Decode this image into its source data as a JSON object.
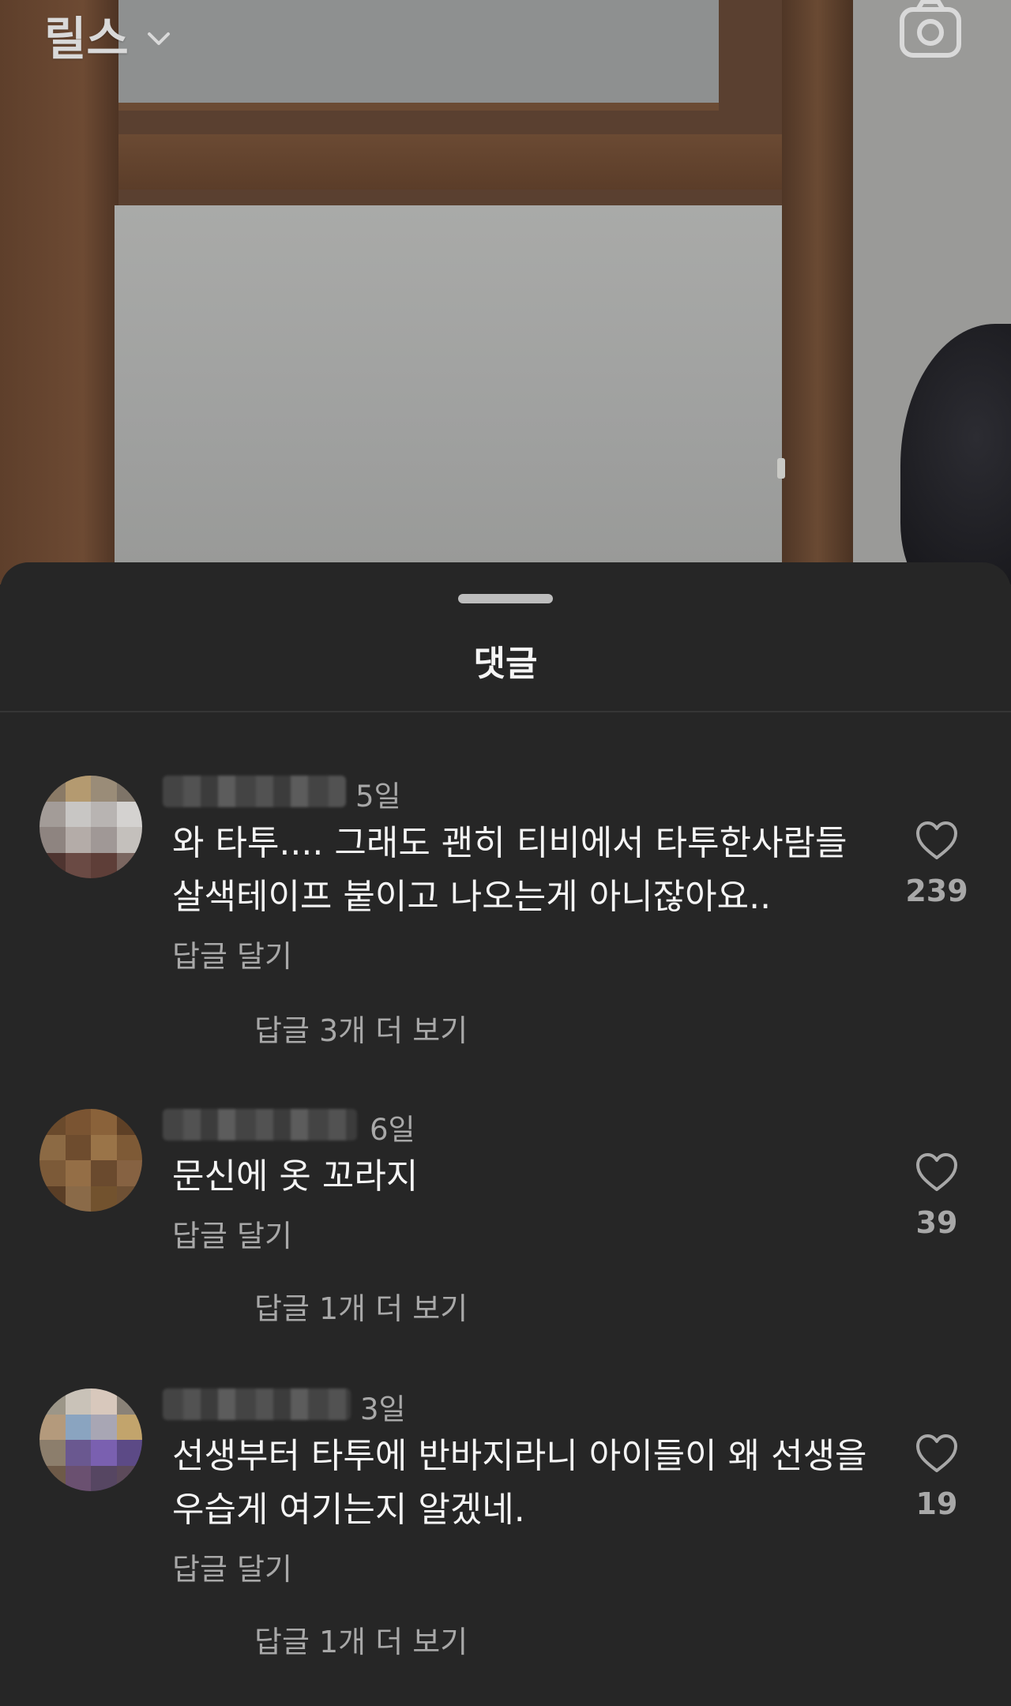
{
  "header": {
    "title": "릴스"
  },
  "sheet": {
    "title": "댓글"
  },
  "comments": [
    {
      "time": "5일",
      "text": "와 타투.... 그래도 괜히 티비에서 타투한사람들 살색테이프 붙이고 나오는게 아니잖아요..",
      "reply_label": "답글 달기",
      "more_replies": "답글 3개 더 보기",
      "likes": "239"
    },
    {
      "time": "6일",
      "text": "문신에 옷 꼬라지",
      "reply_label": "답글 달기",
      "more_replies": "답글 1개 더 보기",
      "likes": "39"
    },
    {
      "time": "3일",
      "text": "선생부터 타투에 반바지라니 아이들이 왜 선생을 우습게 여기는지 알겠네.",
      "reply_label": "답글 달기",
      "more_replies": "답글 1개 더 보기",
      "likes": "19"
    }
  ],
  "icons": {
    "camera": "camera-icon",
    "chevron": "chevron-down-icon",
    "like": "heart-outline-icon"
  },
  "colors": {
    "sheet_bg": "#262626",
    "primary_text": "#f5f5f5",
    "secondary_text": "#a8a8a8"
  }
}
